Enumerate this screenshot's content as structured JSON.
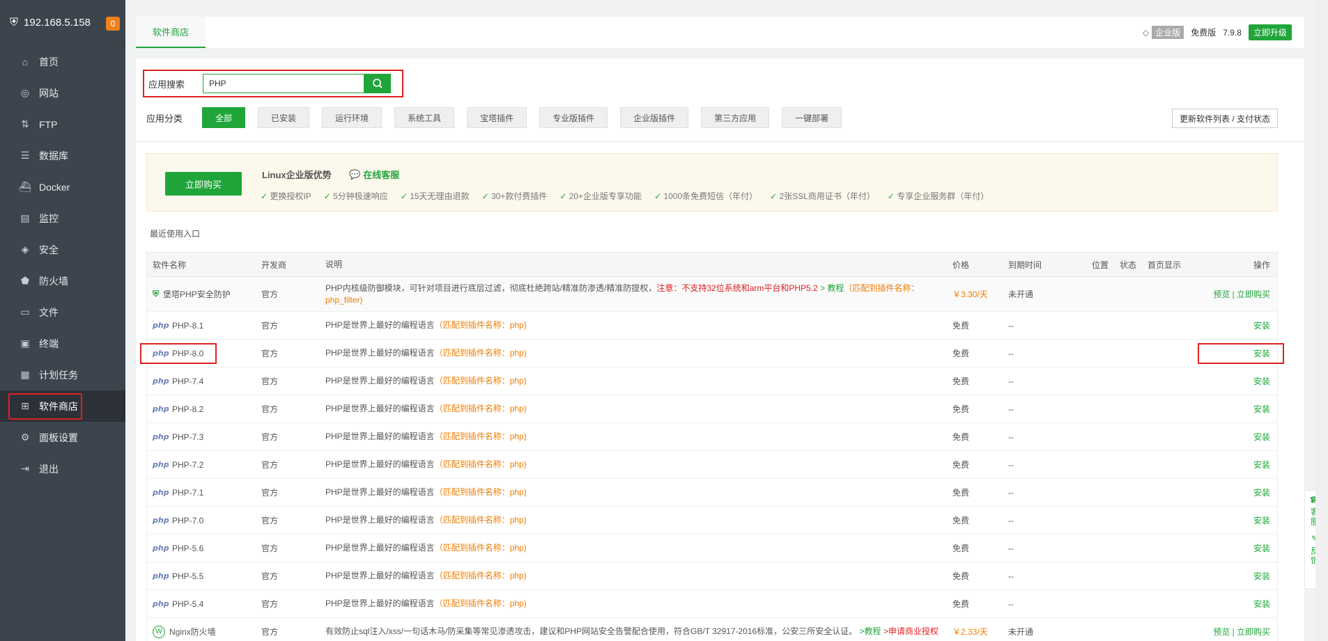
{
  "sidebar": {
    "ip": "192.168.5.158",
    "badge": "0",
    "items": [
      {
        "label": "首页",
        "icon": "home-icon",
        "glyph": "⌂"
      },
      {
        "label": "网站",
        "icon": "globe-icon",
        "glyph": "◎"
      },
      {
        "label": "FTP",
        "icon": "ftp-icon",
        "glyph": "⇅"
      },
      {
        "label": "数据库",
        "icon": "database-icon",
        "glyph": "☰"
      },
      {
        "label": "Docker",
        "icon": "docker-icon",
        "glyph": "⛴"
      },
      {
        "label": "监控",
        "icon": "monitor-icon",
        "glyph": "▤"
      },
      {
        "label": "安全",
        "icon": "shield-icon",
        "glyph": "◈"
      },
      {
        "label": "防火墙",
        "icon": "firewall-icon",
        "glyph": "⬟"
      },
      {
        "label": "文件",
        "icon": "folder-icon",
        "glyph": "▭"
      },
      {
        "label": "终端",
        "icon": "terminal-icon",
        "glyph": "▣"
      },
      {
        "label": "计划任务",
        "icon": "calendar-icon",
        "glyph": "▦"
      },
      {
        "label": "软件商店",
        "icon": "apps-grid-icon",
        "glyph": "⊞"
      },
      {
        "label": "面板设置",
        "icon": "gear-icon",
        "glyph": "⚙"
      },
      {
        "label": "退出",
        "icon": "logout-icon",
        "glyph": "⇥"
      }
    ],
    "active_index": 11
  },
  "topbar": {
    "tab": "软件商店",
    "edition_tag": "企业版",
    "free_label": "免费版",
    "version": "7.9.8",
    "upgrade": "立即升级"
  },
  "search": {
    "label": "应用搜索",
    "value": "PHP"
  },
  "categories": {
    "label": "应用分类",
    "items": [
      "全部",
      "已安装",
      "运行环境",
      "系统工具",
      "宝塔插件",
      "专业版插件",
      "企业版插件",
      "第三方应用",
      "一键部署"
    ],
    "active": 0,
    "refresh": "更新软件列表 / 支付状态"
  },
  "promo": {
    "buy": "立即购买",
    "title": "Linux企业版优势",
    "service": "在线客服",
    "features": [
      "更换授权IP",
      "5分钟极速响应",
      "15天无理由退款",
      "30+款付费插件",
      "20+企业版专享功能",
      "1000条免费短信（年付）",
      "2张SSL商用证书（年付）",
      "专享企业服务群（年付）"
    ]
  },
  "recent_label": "最近使用入口",
  "table": {
    "headers": {
      "name": "软件名称",
      "dev": "开发商",
      "desc": "说明",
      "price": "价格",
      "expire": "到期时间",
      "pos": "位置",
      "status": "状态",
      "home": "首页显示",
      "op": "操作"
    },
    "first_row": {
      "name": "堡塔PHP安全防护",
      "dev": "官方",
      "desc_main": "PHP内核级防御模块，可针对项目进行底层过滤，彻底杜绝跨站/精准防渗透/精准防提权，",
      "desc_note": "注意：不支持32位系统和arm平台和PHP5.2",
      "desc_link": " > 教程",
      "desc_match": "（匹配到插件名称：php_filter)",
      "price": "￥3.30/天",
      "expire": "未开通",
      "op": "预览 | 立即购买"
    },
    "php_rows": [
      {
        "name": "PHP-8.1"
      },
      {
        "name": "PHP-8.0"
      },
      {
        "name": "PHP-7.4"
      },
      {
        "name": "PHP-8.2"
      },
      {
        "name": "PHP-7.3"
      },
      {
        "name": "PHP-7.2"
      },
      {
        "name": "PHP-7.1"
      },
      {
        "name": "PHP-7.0"
      },
      {
        "name": "PHP-5.6"
      },
      {
        "name": "PHP-5.5"
      },
      {
        "name": "PHP-5.4"
      }
    ],
    "php_common": {
      "dev": "官方",
      "desc": "PHP是世界上最好的编程语言",
      "match": "（匹配到插件名称：php)",
      "price": "免费",
      "expire": "--",
      "op": "安装",
      "logo": "php"
    },
    "last_row": {
      "name": "Nginx防火墙",
      "dev": "官方",
      "desc_main": "有效防止sql注入/xss/一句话木马/防采集等常见渗透攻击，建议和PHP网站安全告警配合使用，符合GB/T 32917-2016标准，公安三所安全认证。",
      "desc_link": " >教程",
      "desc_note": " >申请商业授权",
      "price": "￥2.33/天",
      "expire": "未开通",
      "op": "预览 | 立即购买"
    }
  },
  "float": {
    "service": "客服",
    "feedback": "反馈"
  }
}
